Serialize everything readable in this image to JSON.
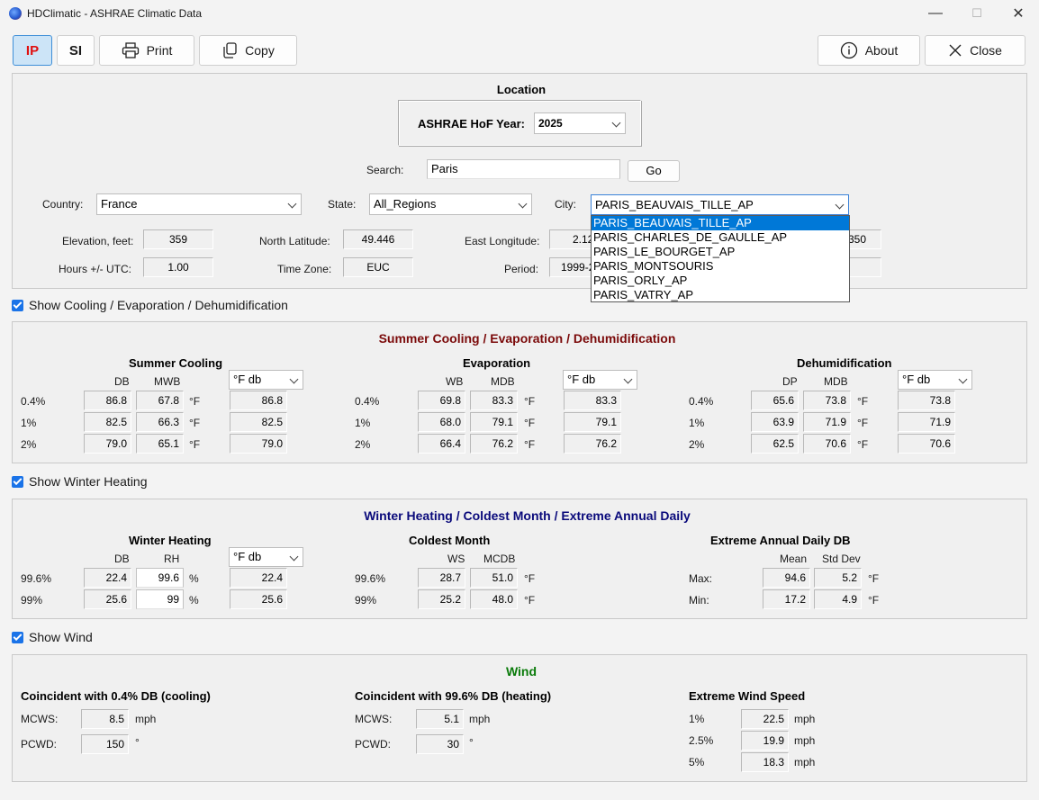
{
  "window": {
    "title": "HDClimatic - ASHRAE Climatic Data",
    "controls": {
      "minimize": "—",
      "maximize": "☐",
      "close": "✕"
    }
  },
  "toolbar": {
    "ip": "IP",
    "si": "SI",
    "print": "Print",
    "copy": "Copy",
    "about": "About",
    "close": "Close"
  },
  "location": {
    "title": "Location",
    "hof_label": "ASHRAE HoF Year:",
    "hof_value": "2025",
    "search_label": "Search:",
    "search_value": "Paris",
    "go": "Go",
    "country_label": "Country:",
    "country_value": "France",
    "state_label": "State:",
    "state_value": "All_Regions",
    "city_label": "City:",
    "city_value": "PARIS_BEAUVAIS_TILLE_AP",
    "city_options": [
      "PARIS_BEAUVAIS_TILLE_AP",
      "PARIS_CHARLES_DE_GAULLE_AP",
      "PARIS_LE_BOURGET_AP",
      "PARIS_MONTSOURIS",
      "PARIS_ORLY_AP",
      "PARIS_VATRY_AP"
    ],
    "elev_label": "Elevation, feet:",
    "elev_value": "359",
    "lat_label": "North Latitude:",
    "lat_value": "49.446",
    "lon_label": "East Longitude:",
    "lon_value": "2.12",
    "extra_value": "350",
    "utc_label": "Hours +/- UTC:",
    "utc_value": "1.00",
    "tz_label": "Time Zone:",
    "tz_value": "EUC",
    "period_label": "Period:",
    "period_value": "1999-2"
  },
  "cooling": {
    "toggle": "Show Cooling / Evaporation / Dehumidification",
    "title": "Summer Cooling / Evaporation / Dehumidification",
    "title_color": "#7b0a0a",
    "unit_option": "°F db",
    "unit": "°F",
    "summer": {
      "title": "Summer Cooling",
      "col1": "DB",
      "col2": "MWB",
      "rows": [
        {
          "label": "0.4%",
          "a": "86.8",
          "b": "67.8",
          "c": "86.8"
        },
        {
          "label": "1%",
          "a": "82.5",
          "b": "66.3",
          "c": "82.5"
        },
        {
          "label": "2%",
          "a": "79.0",
          "b": "65.1",
          "c": "79.0"
        }
      ]
    },
    "evap": {
      "title": "Evaporation",
      "col1": "WB",
      "col2": "MDB",
      "rows": [
        {
          "label": "0.4%",
          "a": "69.8",
          "b": "83.3",
          "c": "83.3"
        },
        {
          "label": "1%",
          "a": "68.0",
          "b": "79.1",
          "c": "79.1"
        },
        {
          "label": "2%",
          "a": "66.4",
          "b": "76.2",
          "c": "76.2"
        }
      ]
    },
    "dehum": {
      "title": "Dehumidification",
      "col1": "DP",
      "col2": "MDB",
      "rows": [
        {
          "label": "0.4%",
          "a": "65.6",
          "b": "73.8",
          "c": "73.8"
        },
        {
          "label": "1%",
          "a": "63.9",
          "b": "71.9",
          "c": "71.9"
        },
        {
          "label": "2%",
          "a": "62.5",
          "b": "70.6",
          "c": "70.6"
        }
      ]
    }
  },
  "heating": {
    "toggle": "Show Winter Heating",
    "title": "Winter Heating / Coldest Month / Extreme Annual Daily",
    "title_color": "#0a0a7b",
    "winter": {
      "title": "Winter Heating",
      "col1": "DB",
      "col2": "RH",
      "unit2": "%",
      "unit_option": "°F db",
      "rows": [
        {
          "label": "99.6%",
          "a": "22.4",
          "b": "99.6",
          "c": "22.4"
        },
        {
          "label": "99%",
          "a": "25.6",
          "b": "99",
          "c": "25.6"
        }
      ]
    },
    "coldest": {
      "title": "Coldest Month",
      "col1": "WS",
      "col2": "MCDB",
      "unit": "°F",
      "rows": [
        {
          "label": "99.6%",
          "a": "28.7",
          "b": "51.0"
        },
        {
          "label": "99%",
          "a": "25.2",
          "b": "48.0"
        }
      ]
    },
    "extreme": {
      "title": "Extreme Annual Daily DB",
      "col1": "Mean",
      "col2": "Std Dev",
      "unit": "°F",
      "rows": [
        {
          "label": "Max:",
          "a": "94.6",
          "b": "5.2"
        },
        {
          "label": "Min:",
          "a": "17.2",
          "b": "4.9"
        }
      ]
    }
  },
  "wind": {
    "toggle": "Show Wind",
    "title": "Wind",
    "title_color": "#0a7b0a",
    "cooling": {
      "title": "Coincident with 0.4% DB (cooling)",
      "mcws_label": "MCWS:",
      "mcws_value": "8.5",
      "mcws_unit": "mph",
      "pcwd_label": "PCWD:",
      "pcwd_value": "150",
      "pcwd_unit": "°"
    },
    "heating": {
      "title": "Coincident with 99.6% DB (heating)",
      "mcws_label": "MCWS:",
      "mcws_value": "5.1",
      "mcws_unit": "mph",
      "pcwd_label": "PCWD:",
      "pcwd_value": "30",
      "pcwd_unit": "°"
    },
    "extreme": {
      "title": "Extreme Wind Speed",
      "unit": "mph",
      "rows": [
        {
          "label": "1%",
          "value": "22.5"
        },
        {
          "label": "2.5%",
          "value": "19.9"
        },
        {
          "label": "5%",
          "value": "18.3"
        }
      ]
    }
  }
}
